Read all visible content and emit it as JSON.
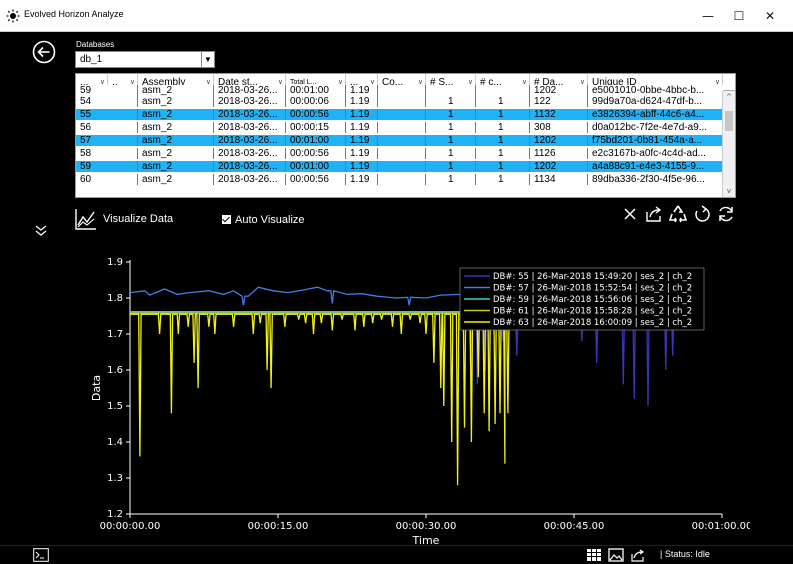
{
  "window": {
    "title": "Evolved Horizon Analyze",
    "minimize": "—",
    "maximize": "☐",
    "close": "✕"
  },
  "database": {
    "label": "Databases",
    "selected": "db_1"
  },
  "table": {
    "columns": [
      "...",
      "..",
      "Assembly",
      "Date st...",
      "Total L...",
      "...",
      "Co...",
      "# S...",
      "# c...",
      "# Da...",
      "Unique ID"
    ],
    "partial_row": [
      "59",
      "",
      "asm_2",
      "2018-03-26...",
      "00:01:00",
      "1.19",
      "",
      "",
      "",
      "1202",
      "e5001010-0bbe-4bbc-b..."
    ],
    "rows": [
      {
        "id": "54",
        "assembly": "asm_2",
        "date": "2018-03-26...",
        "total": "00:00:06",
        "v": "1.19",
        "s": "1",
        "c": "1",
        "da": "122",
        "uid": "99d9a70a-d624-47df-b...",
        "selected": false
      },
      {
        "id": "55",
        "assembly": "asm_2",
        "date": "2018-03-26...",
        "total": "00:00:56",
        "v": "1.19",
        "s": "1",
        "c": "1",
        "da": "1132",
        "uid": "e3826394-abff-44c6-a4...",
        "selected": true
      },
      {
        "id": "56",
        "assembly": "asm_2",
        "date": "2018-03-26...",
        "total": "00:00:15",
        "v": "1.19",
        "s": "1",
        "c": "1",
        "da": "308",
        "uid": "d0a012bc-7f2e-4e7d-a9...",
        "selected": false
      },
      {
        "id": "57",
        "assembly": "asm_2",
        "date": "2018-03-26...",
        "total": "00:01:00",
        "v": "1.19",
        "s": "1",
        "c": "1",
        "da": "1202",
        "uid": "f75bd201-0b81-454a-a...",
        "selected": true
      },
      {
        "id": "58",
        "assembly": "asm_2",
        "date": "2018-03-26...",
        "total": "00:00:56",
        "v": "1.19",
        "s": "1",
        "c": "1",
        "da": "1126",
        "uid": "e2c3167b-a0fc-4c4d-ad...",
        "selected": false
      },
      {
        "id": "59",
        "assembly": "asm_2",
        "date": "2018-03-26...",
        "total": "00:01:00",
        "v": "1.19",
        "s": "1",
        "c": "1",
        "da": "1202",
        "uid": "a4a88c91-e4e3-4155-9...",
        "selected": true
      },
      {
        "id": "60",
        "assembly": "asm_2",
        "date": "2018-03-26...",
        "total": "00:00:56",
        "v": "1.19",
        "s": "1",
        "c": "1",
        "da": "1134",
        "uid": "89dba336-2f30-4f5e-96...",
        "selected": false
      }
    ]
  },
  "visualize": {
    "label": "Visualize Data",
    "auto_label": "Auto Visualize",
    "auto_checked": true
  },
  "toolbar_icons": [
    "close-icon",
    "export-icon",
    "recycle-icon",
    "redo-icon",
    "refresh-icon"
  ],
  "status": {
    "text": "| Status: Idle"
  },
  "colors": {
    "selected_row": "#1fb3f5",
    "series_55": "#3a35b5",
    "series_57": "#3f7fe6",
    "series_59": "#2bd6b5",
    "series_61": "#c9c818",
    "series_63": "#f1f014"
  },
  "chart_data": {
    "type": "line",
    "xlabel": "Time",
    "ylabel": "Data",
    "xlim": [
      0,
      60
    ],
    "ylim": [
      1.2,
      1.9
    ],
    "xticks": [
      "00:00:00.00",
      "00:00:15.00",
      "00:00:30.00",
      "00:00:45.00",
      "00:01:00.00"
    ],
    "yticks": [
      "1.2",
      "1.3",
      "1.4",
      "1.5",
      "1.6",
      "1.7",
      "1.8",
      "1.9"
    ],
    "legend_position": "top-right",
    "series": [
      {
        "name": "DB#: 55 | 26-Mar-2018 15:49:20 | ses_2 | ch_2",
        "color": "#3a35b5",
        "baseline": 1.76,
        "x_end": 56,
        "dips": [
          [
            34.5,
            1.62
          ],
          [
            35.2,
            1.56
          ],
          [
            36.0,
            1.6
          ],
          [
            37.8,
            1.68
          ],
          [
            39.2,
            1.64
          ],
          [
            45.8,
            1.68
          ],
          [
            47.3,
            1.62
          ],
          [
            50.0,
            1.56
          ],
          [
            51.1,
            1.52
          ],
          [
            52.5,
            1.5
          ],
          [
            54.3,
            1.6
          ],
          [
            55.0,
            1.64
          ]
        ]
      },
      {
        "name": "DB#: 57 | 26-Mar-2018 15:52:54 | ses_2 | ch_2",
        "color": "#3f7fe6",
        "points": [
          [
            0,
            1.815
          ],
          [
            1.5,
            1.82
          ],
          [
            2.0,
            1.808
          ],
          [
            3.5,
            1.825
          ],
          [
            4.8,
            1.81
          ],
          [
            6.0,
            1.815
          ],
          [
            8.0,
            1.82
          ],
          [
            9.5,
            1.81
          ],
          [
            10.5,
            1.82
          ],
          [
            12.0,
            1.805
          ],
          [
            13.0,
            1.83
          ],
          [
            14.5,
            1.82
          ],
          [
            16.0,
            1.815
          ],
          [
            17.5,
            1.822
          ],
          [
            19.0,
            1.83
          ],
          [
            20.0,
            1.82
          ],
          [
            22.0,
            1.81
          ],
          [
            23.5,
            1.812
          ],
          [
            25.0,
            1.805
          ],
          [
            27.0,
            1.8
          ],
          [
            28.5,
            1.802
          ],
          [
            30.0,
            1.8
          ],
          [
            31.5,
            1.808
          ],
          [
            33.5,
            1.81
          ],
          [
            35.0,
            1.805
          ],
          [
            36.0,
            1.8
          ],
          [
            37.2,
            1.803
          ]
        ],
        "dips": [
          [
            11.5,
            1.78
          ],
          [
            20.5,
            1.785
          ],
          [
            28.3,
            1.78
          ],
          [
            34.8,
            1.787
          ]
        ]
      },
      {
        "name": "DB#: 59 | 26-Mar-2018 15:56:06 | ses_2 | ch_2",
        "color": "#2bd6b5",
        "baseline": 1.762,
        "x_end": 38,
        "dips": []
      },
      {
        "name": "DB#: 61 | 26-Mar-2018 15:58:28 | ses_2 | ch_2",
        "color": "#c9c818",
        "baseline": 1.758,
        "x_end": 38,
        "dips": []
      },
      {
        "name": "DB#: 63 | 26-Mar-2018 16:00:09 | ses_2 | ch_2",
        "color": "#f1f014",
        "baseline": 1.755,
        "x_end": 38,
        "dips": [
          [
            1.0,
            1.36
          ],
          [
            3.0,
            1.7
          ],
          [
            4.2,
            1.48
          ],
          [
            4.9,
            1.7
          ],
          [
            5.9,
            1.72
          ],
          [
            6.5,
            1.62
          ],
          [
            6.9,
            1.55
          ],
          [
            8.0,
            1.72
          ],
          [
            8.6,
            1.7
          ],
          [
            10.5,
            1.72
          ],
          [
            12.5,
            1.7
          ],
          [
            13.2,
            1.73
          ],
          [
            13.9,
            1.6
          ],
          [
            14.3,
            1.55
          ],
          [
            15.7,
            1.72
          ],
          [
            17.1,
            1.74
          ],
          [
            17.8,
            1.73
          ],
          [
            18.6,
            1.7
          ],
          [
            19.4,
            1.73
          ],
          [
            20.5,
            1.71
          ],
          [
            21.5,
            1.74
          ],
          [
            22.8,
            1.71
          ],
          [
            23.7,
            1.72
          ],
          [
            24.6,
            1.73
          ],
          [
            25.5,
            1.74
          ],
          [
            26.6,
            1.72
          ],
          [
            27.5,
            1.7
          ],
          [
            28.4,
            1.74
          ],
          [
            29.4,
            1.73
          ],
          [
            30.0,
            1.7
          ],
          [
            30.8,
            1.62
          ],
          [
            31.5,
            1.55
          ],
          [
            31.8,
            1.5
          ],
          [
            32.6,
            1.4
          ],
          [
            33.2,
            1.28
          ],
          [
            33.9,
            1.44
          ],
          [
            34.6,
            1.4
          ],
          [
            35.3,
            1.58
          ],
          [
            35.9,
            1.48
          ],
          [
            36.4,
            1.43
          ],
          [
            37.0,
            1.45
          ],
          [
            37.5,
            1.48
          ],
          [
            38.0,
            1.34
          ],
          [
            38.3,
            1.48
          ]
        ]
      }
    ]
  }
}
